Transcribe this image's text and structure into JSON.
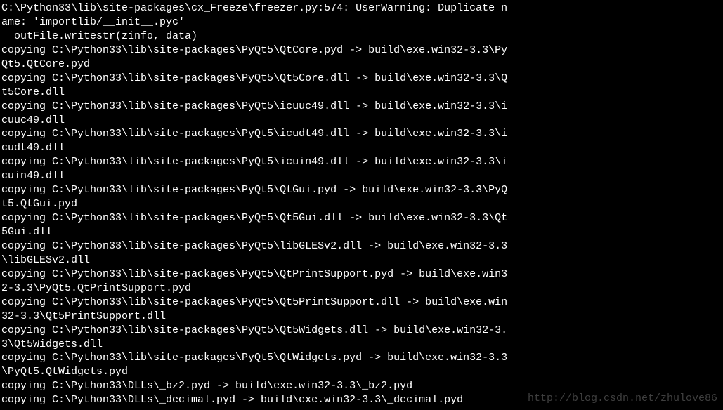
{
  "terminal": {
    "lines": [
      "C:\\Python33\\lib\\site-packages\\cx_Freeze\\freezer.py:574: UserWarning: Duplicate n",
      "ame: 'importlib/__init__.pyc'",
      "  outFile.writestr(zinfo, data)",
      "copying C:\\Python33\\lib\\site-packages\\PyQt5\\QtCore.pyd -> build\\exe.win32-3.3\\Py",
      "Qt5.QtCore.pyd",
      "copying C:\\Python33\\lib\\site-packages\\PyQt5\\Qt5Core.dll -> build\\exe.win32-3.3\\Q",
      "t5Core.dll",
      "copying C:\\Python33\\lib\\site-packages\\PyQt5\\icuuc49.dll -> build\\exe.win32-3.3\\i",
      "cuuc49.dll",
      "copying C:\\Python33\\lib\\site-packages\\PyQt5\\icudt49.dll -> build\\exe.win32-3.3\\i",
      "cudt49.dll",
      "copying C:\\Python33\\lib\\site-packages\\PyQt5\\icuin49.dll -> build\\exe.win32-3.3\\i",
      "cuin49.dll",
      "copying C:\\Python33\\lib\\site-packages\\PyQt5\\QtGui.pyd -> build\\exe.win32-3.3\\PyQ",
      "t5.QtGui.pyd",
      "copying C:\\Python33\\lib\\site-packages\\PyQt5\\Qt5Gui.dll -> build\\exe.win32-3.3\\Qt",
      "5Gui.dll",
      "copying C:\\Python33\\lib\\site-packages\\PyQt5\\libGLESv2.dll -> build\\exe.win32-3.3",
      "\\libGLESv2.dll",
      "copying C:\\Python33\\lib\\site-packages\\PyQt5\\QtPrintSupport.pyd -> build\\exe.win3",
      "2-3.3\\PyQt5.QtPrintSupport.pyd",
      "copying C:\\Python33\\lib\\site-packages\\PyQt5\\Qt5PrintSupport.dll -> build\\exe.win",
      "32-3.3\\Qt5PrintSupport.dll",
      "copying C:\\Python33\\lib\\site-packages\\PyQt5\\Qt5Widgets.dll -> build\\exe.win32-3.",
      "3\\Qt5Widgets.dll",
      "copying C:\\Python33\\lib\\site-packages\\PyQt5\\QtWidgets.pyd -> build\\exe.win32-3.3",
      "\\PyQt5.QtWidgets.pyd",
      "copying C:\\Python33\\DLLs\\_bz2.pyd -> build\\exe.win32-3.3\\_bz2.pyd",
      "copying C:\\Python33\\DLLs\\_decimal.pyd -> build\\exe.win32-3.3\\_decimal.pyd"
    ]
  },
  "watermark": "http://blog.csdn.net/zhulove86"
}
